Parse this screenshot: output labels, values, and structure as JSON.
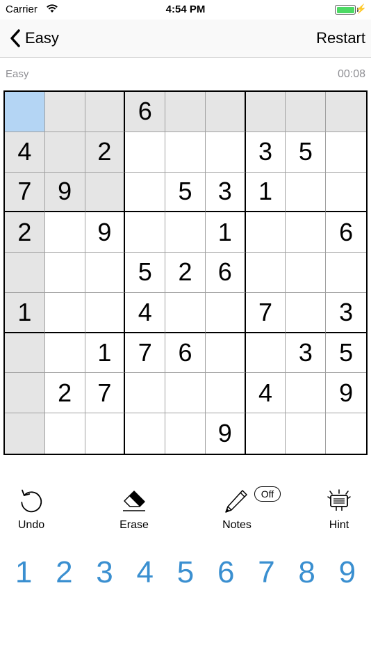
{
  "status_bar": {
    "carrier": "Carrier",
    "time": "4:54 PM"
  },
  "nav": {
    "back_label": "Easy",
    "restart_label": "Restart"
  },
  "info": {
    "difficulty": "Easy",
    "timer": "00:08"
  },
  "board": {
    "rows": [
      [
        "",
        "",
        "",
        "6",
        "",
        "",
        "",
        "",
        ""
      ],
      [
        "4",
        "",
        "2",
        "",
        "",
        "",
        "3",
        "5",
        ""
      ],
      [
        "7",
        "9",
        "",
        "",
        "5",
        "3",
        "1",
        "",
        ""
      ],
      [
        "2",
        "",
        "9",
        "",
        "",
        "1",
        "",
        "",
        "6"
      ],
      [
        "",
        "",
        "",
        "5",
        "2",
        "6",
        "",
        "",
        ""
      ],
      [
        "1",
        "",
        "",
        "4",
        "",
        "",
        "7",
        "",
        "3"
      ],
      [
        "",
        "",
        "1",
        "7",
        "6",
        "",
        "",
        "3",
        "5"
      ],
      [
        "",
        "2",
        "7",
        "",
        "",
        "",
        "4",
        "",
        "9"
      ],
      [
        "",
        "",
        "",
        "",
        "",
        "9",
        "",
        "",
        ""
      ]
    ],
    "selected": [
      0,
      0
    ],
    "selected_color": "#b4d5f4",
    "highlight_color": "#e5e5e5"
  },
  "tools": {
    "undo": {
      "label": "Undo",
      "icon": "undo-icon"
    },
    "erase": {
      "label": "Erase",
      "icon": "eraser-icon"
    },
    "notes": {
      "label": "Notes",
      "icon": "pencil-icon",
      "state": "Off"
    },
    "hint": {
      "label": "Hint",
      "icon": "hint-icon"
    }
  },
  "number_pad": {
    "keys": [
      "1",
      "2",
      "3",
      "4",
      "5",
      "6",
      "7",
      "8",
      "9"
    ],
    "color": "#3a8fd0"
  }
}
